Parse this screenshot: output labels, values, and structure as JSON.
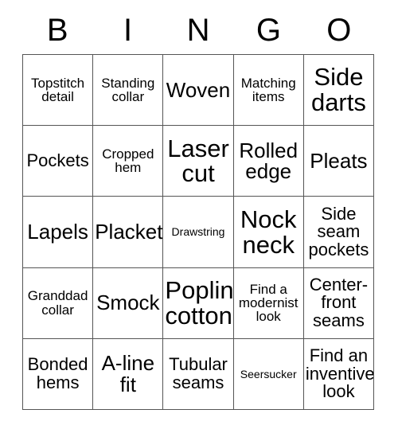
{
  "card": {
    "header_letters": [
      "B",
      "I",
      "N",
      "G",
      "O"
    ],
    "rows": [
      [
        {
          "text": "Topstitch detail",
          "size": "sm"
        },
        {
          "text": "Standing collar",
          "size": "sm"
        },
        {
          "text": "Woven",
          "size": "lg"
        },
        {
          "text": "Matching items",
          "size": "sm"
        },
        {
          "text": "Side darts",
          "size": "xl"
        }
      ],
      [
        {
          "text": "Pockets",
          "size": "md"
        },
        {
          "text": "Cropped hem",
          "size": "sm"
        },
        {
          "text": "Laser cut",
          "size": "xl"
        },
        {
          "text": "Rolled edge",
          "size": "lg"
        },
        {
          "text": "Pleats",
          "size": "lg"
        }
      ],
      [
        {
          "text": "Lapels",
          "size": "lg"
        },
        {
          "text": "Placket",
          "size": "lg"
        },
        {
          "text": "Drawstring",
          "size": "xs"
        },
        {
          "text": "Nock neck",
          "size": "xl"
        },
        {
          "text": "Side seam pockets",
          "size": "md"
        }
      ],
      [
        {
          "text": "Granddad collar",
          "size": "sm"
        },
        {
          "text": "Smock",
          "size": "lg"
        },
        {
          "text": "Poplin cotton",
          "size": "xl"
        },
        {
          "text": "Find a modernist look",
          "size": "sm"
        },
        {
          "text": "Center-front seams",
          "size": "md"
        }
      ],
      [
        {
          "text": "Bonded hems",
          "size": "md"
        },
        {
          "text": "A-line fit",
          "size": "lg"
        },
        {
          "text": "Tubular seams",
          "size": "md"
        },
        {
          "text": "Seersucker",
          "size": "xs"
        },
        {
          "text": "Find an inventive look",
          "size": "md"
        }
      ]
    ]
  },
  "colors": {
    "background": "#ffffff",
    "text": "#000000",
    "grid_line": "#555555"
  }
}
